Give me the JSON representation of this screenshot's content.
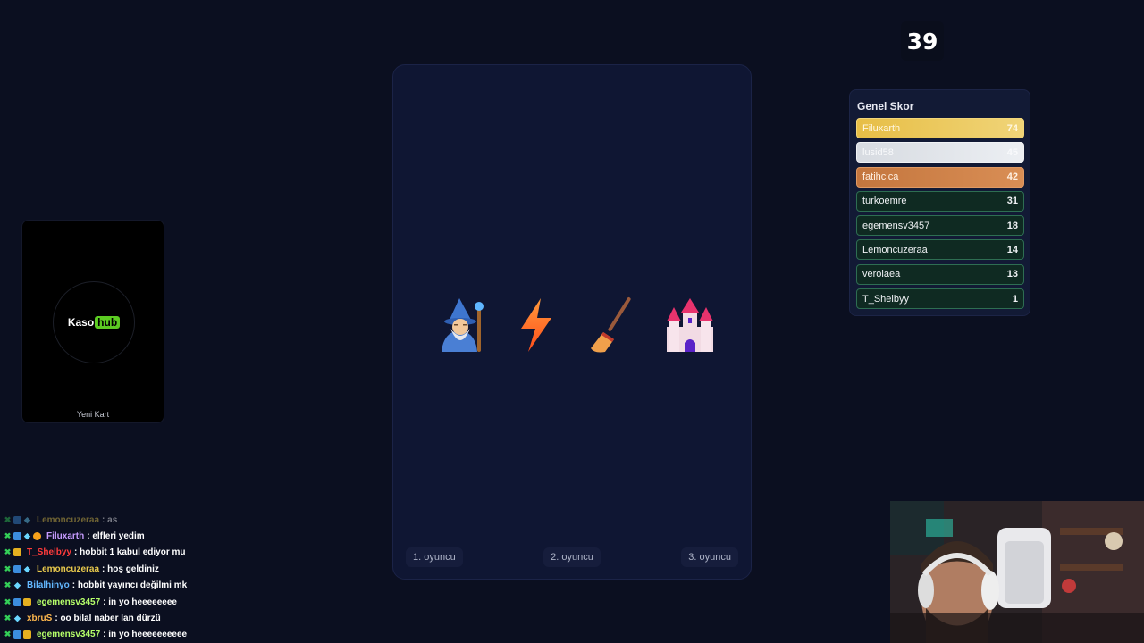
{
  "timer": {
    "value": "39"
  },
  "left_card": {
    "logo_part1": "Kaso",
    "logo_part2": "hub",
    "caption": "Yeni Kart"
  },
  "board": {
    "emojis": [
      "wizard",
      "lightning",
      "broom",
      "castle"
    ],
    "players": [
      "1. oyuncu",
      "2. oyuncu",
      "3. oyuncu"
    ]
  },
  "scoreboard": {
    "title": "Genel Skor",
    "rows": [
      {
        "name": "Filuxarth",
        "points": "74",
        "rank_style": "gold"
      },
      {
        "name": "lusid58",
        "points": "45",
        "rank_style": "silver"
      },
      {
        "name": "fatihcica",
        "points": "42",
        "rank_style": "bronze"
      },
      {
        "name": "turkoemre",
        "points": "31",
        "rank_style": "normal"
      },
      {
        "name": "egemensv3457",
        "points": "18",
        "rank_style": "normal"
      },
      {
        "name": "Lemoncuzeraa",
        "points": "14",
        "rank_style": "normal"
      },
      {
        "name": "verolaea",
        "points": "13",
        "rank_style": "normal"
      },
      {
        "name": "T_Shelbyy",
        "points": "1",
        "rank_style": "normal"
      }
    ]
  },
  "chat": [
    {
      "user": "Lemoncuzeraa",
      "message": ": as",
      "color": "#e8c94c",
      "faded": true,
      "badges": [
        "sword-icon",
        "blue-badge-icon",
        "gem-icon"
      ]
    },
    {
      "user": "Filuxarth",
      "message": ": elfleri yedim",
      "color": "#c79cff",
      "faded": false,
      "badges": [
        "sword-icon",
        "blue-badge-icon",
        "gem-icon",
        "orange-badge-icon"
      ]
    },
    {
      "user": "T_Shelbyy",
      "message": ": hobbit 1 kabul ediyor mu",
      "color": "#ff3b3b",
      "faded": false,
      "badges": [
        "sword-icon",
        "crown-badge-icon"
      ]
    },
    {
      "user": "Lemoncuzeraa",
      "message": ": hoş geldiniz",
      "color": "#e8c94c",
      "faded": false,
      "badges": [
        "sword-icon",
        "blue-badge-icon",
        "gem-icon"
      ]
    },
    {
      "user": "Bilalhinyo",
      "message": ": hobbit yayıncı değilmi mk",
      "color": "#63b8ff",
      "faded": false,
      "badges": [
        "sword-icon",
        "gem-icon"
      ]
    },
    {
      "user": "egemensv3457",
      "message": ": in yo heeeeeeee",
      "color": "#b6ff6a",
      "faded": false,
      "badges": [
        "sword-icon",
        "blue-badge-icon",
        "crown-badge-icon"
      ]
    },
    {
      "user": "xbruS",
      "message": ": oo bilal naber lan dürzü",
      "color": "#ffb84d",
      "faded": false,
      "badges": [
        "sword-icon",
        "gem-icon"
      ]
    },
    {
      "user": "egemensv3457",
      "message": ": in yo heeeeeeeeee",
      "color": "#b6ff6a",
      "faded": false,
      "badges": [
        "sword-icon",
        "blue-badge-icon",
        "crown-badge-icon"
      ]
    }
  ]
}
